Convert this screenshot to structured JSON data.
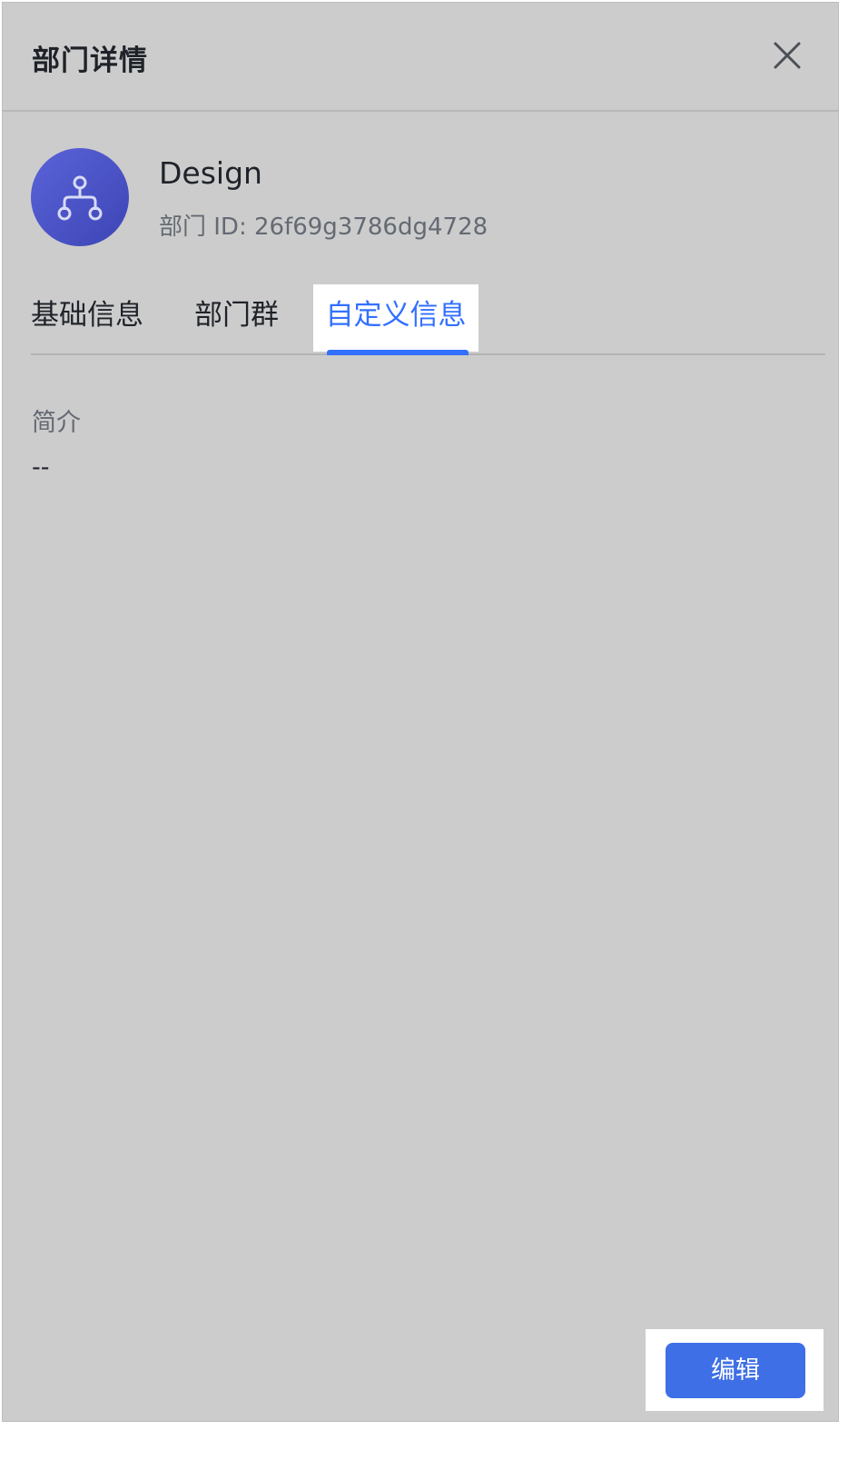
{
  "header": {
    "title": "部门详情",
    "close_icon": "close-icon"
  },
  "department": {
    "avatar_icon": "org-tree-icon",
    "name": "Design",
    "id_text": "部门 ID: 26f69g3786dg4728"
  },
  "tabs": [
    {
      "label": "基础信息",
      "active": false
    },
    {
      "label": "部门群",
      "active": false
    },
    {
      "label": "自定义信息",
      "active": true
    }
  ],
  "custom_info": {
    "field_label": "简介",
    "field_value": "--"
  },
  "footer": {
    "edit_label": "编辑"
  },
  "colors": {
    "accent": "#3370ff",
    "button": "#3f6fe6",
    "avatar": "#4a52c8",
    "overlay": "#cccccc"
  }
}
